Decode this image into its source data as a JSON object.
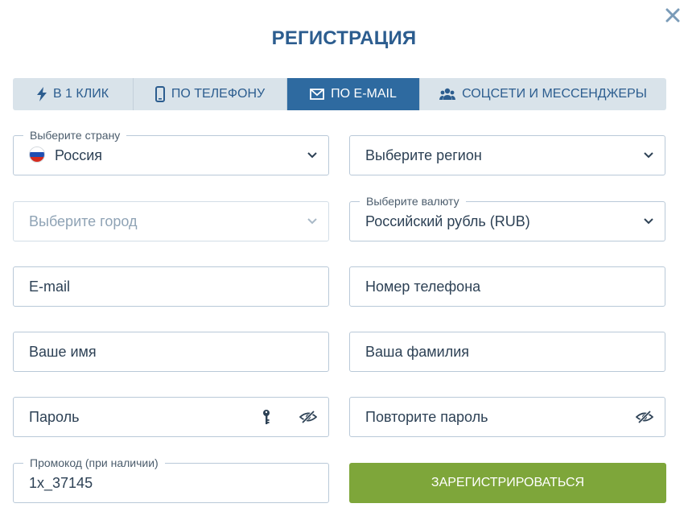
{
  "title": "РЕГИСТРАЦИЯ",
  "tabs": [
    {
      "label": "В 1 КЛИК",
      "icon": "lightning-icon"
    },
    {
      "label": "ПО ТЕЛЕФОНУ",
      "icon": "phone-icon"
    },
    {
      "label": "ПО E-MAIL",
      "icon": "envelope-icon",
      "active": true
    },
    {
      "label": "СОЦСЕТИ И МЕССЕНДЖЕРЫ",
      "icon": "users-icon"
    }
  ],
  "form": {
    "country": {
      "label": "Выберите страну",
      "value": "Россия"
    },
    "region": {
      "placeholder": "Выберите регион"
    },
    "city": {
      "placeholder": "Выберите город"
    },
    "currency": {
      "label": "Выберите валюту",
      "value": "Российский рубль (RUB)"
    },
    "email": {
      "placeholder": "E-mail"
    },
    "phone": {
      "placeholder": "Номер телефона"
    },
    "first_name": {
      "placeholder": "Ваше имя"
    },
    "last_name": {
      "placeholder": "Ваша фамилия"
    },
    "password": {
      "placeholder": "Пароль"
    },
    "password_repeat": {
      "placeholder": "Повторите пароль"
    },
    "promo": {
      "label": "Промокод (при наличии)",
      "value": "1x_37145"
    }
  },
  "submit_label": "ЗАРЕГИСТРИРОВАТЬСЯ",
  "colors": {
    "accent": "#2e6aa0",
    "title": "#2c5d8f",
    "tab_bg": "#d9e3ea",
    "submit": "#7ea63a"
  }
}
